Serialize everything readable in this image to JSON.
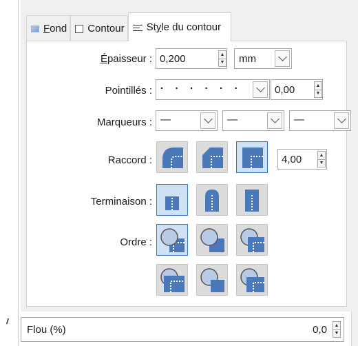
{
  "tabs": [
    {
      "label_prefix": "",
      "label_underline": "F",
      "label_rest": "ond",
      "icon": "fill-icon"
    },
    {
      "label_prefix": "",
      "label_underline": "",
      "label_rest": "Contour",
      "icon": "contour-icon"
    },
    {
      "label_prefix": "St",
      "label_underline": "y",
      "label_rest": "le du contour",
      "icon": "stroke-style-icon",
      "active": true
    }
  ],
  "epaisseur": {
    "label_underline": "É",
    "label_rest": "paisseur :",
    "value": "0,200",
    "unit": "mm"
  },
  "pointilles": {
    "label": "Pointillés :",
    "pattern": "·   ·   ·   ·   ·   ·",
    "value": "0,00"
  },
  "marqueurs": {
    "label": "Marqueurs :",
    "start": "—",
    "middle": "—",
    "end": "—"
  },
  "raccord": {
    "label": "Raccord :",
    "options": [
      "round-join-icon",
      "bevel-join-icon",
      "miter-join-icon"
    ],
    "selected": 2,
    "miter_limit": "4,00"
  },
  "terminaison": {
    "label": "Terminaison :",
    "options": [
      "butt-cap-icon",
      "round-cap-icon",
      "square-cap-icon"
    ],
    "selected": 0
  },
  "ordre": {
    "label": "Ordre :",
    "options": [
      "order-fill-stroke-markers-icon",
      "order-stroke-fill-markers-icon",
      "order-fill-markers-stroke-icon",
      "order-markers-fill-stroke-icon",
      "order-stroke-markers-fill-icon",
      "order-markers-stroke-fill-icon"
    ],
    "selected": 0
  },
  "flou": {
    "label": "Flou (%)",
    "value": "0,0"
  },
  "colors": {
    "accent": "#3a78c2",
    "selected_bg": "#cfe2f5",
    "icon_blue": "#4a78b8"
  }
}
